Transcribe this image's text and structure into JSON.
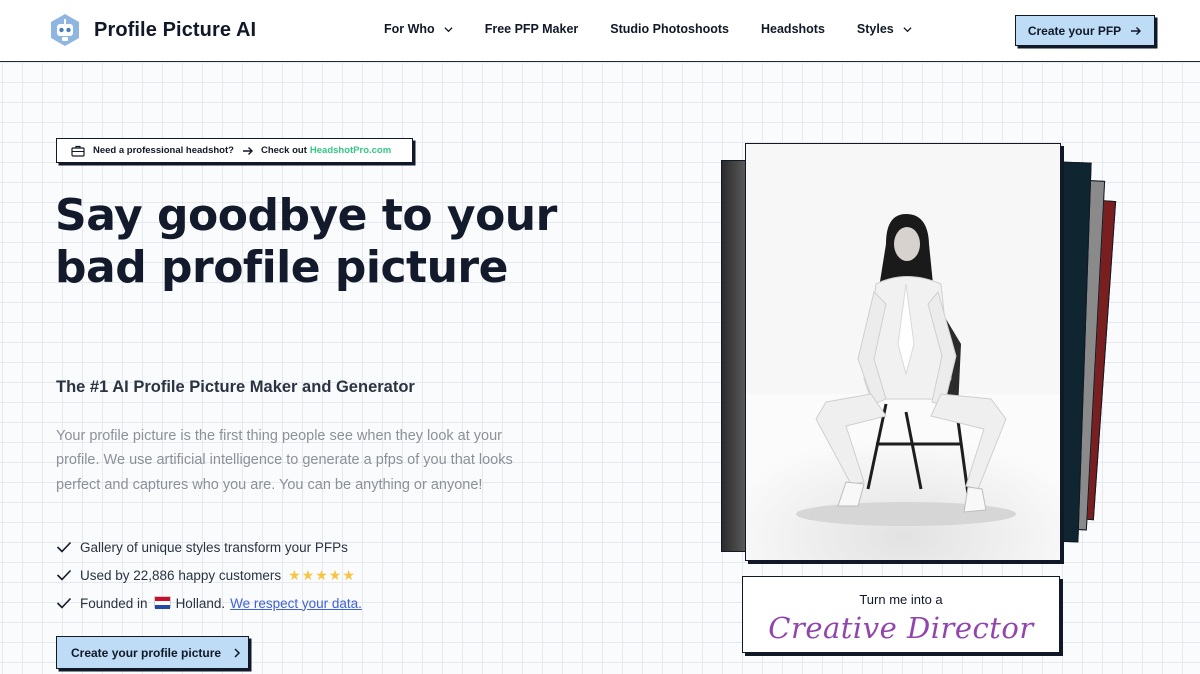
{
  "header": {
    "logo_text": "Profile Picture AI",
    "nav": [
      {
        "label": "For Who",
        "has_dropdown": true
      },
      {
        "label": "Free PFP Maker",
        "has_dropdown": false
      },
      {
        "label": "Studio Photoshoots",
        "has_dropdown": false
      },
      {
        "label": "Headshots",
        "has_dropdown": false
      },
      {
        "label": "Styles",
        "has_dropdown": true
      }
    ],
    "cta_label": "Create your PFP"
  },
  "hero": {
    "promo": {
      "question": "Need a professional headshot?",
      "check_out": "Check out",
      "brand": "HeadshotPro.com"
    },
    "headline": "Say goodbye to your bad profile picture",
    "subheadline": "The #1 AI Profile Picture Maker and Generator",
    "description": "Your profile picture is the first thing people see when they look at your profile. We use artificial intelligence to generate a pfps of you that looks perfect and captures who you are. You can be anything or anyone!",
    "features": {
      "gallery": "Gallery of unique styles transform your PFPs",
      "customers": "Used by 22,886 happy customers",
      "stars": "★★★★★",
      "founded_prefix": "Founded in",
      "founded_country": "Holland.",
      "privacy_link": "We respect your data."
    },
    "cta_label": "Create your profile picture"
  },
  "showcase": {
    "caption_top": "Turn me into a",
    "caption_role": "Creative Director"
  },
  "colors": {
    "accent_button": "#bfdcf7",
    "brand_green": "#34c784",
    "link_blue": "#3f62d8",
    "role_purple": "#9146ad",
    "star_yellow": "#f6c544"
  }
}
